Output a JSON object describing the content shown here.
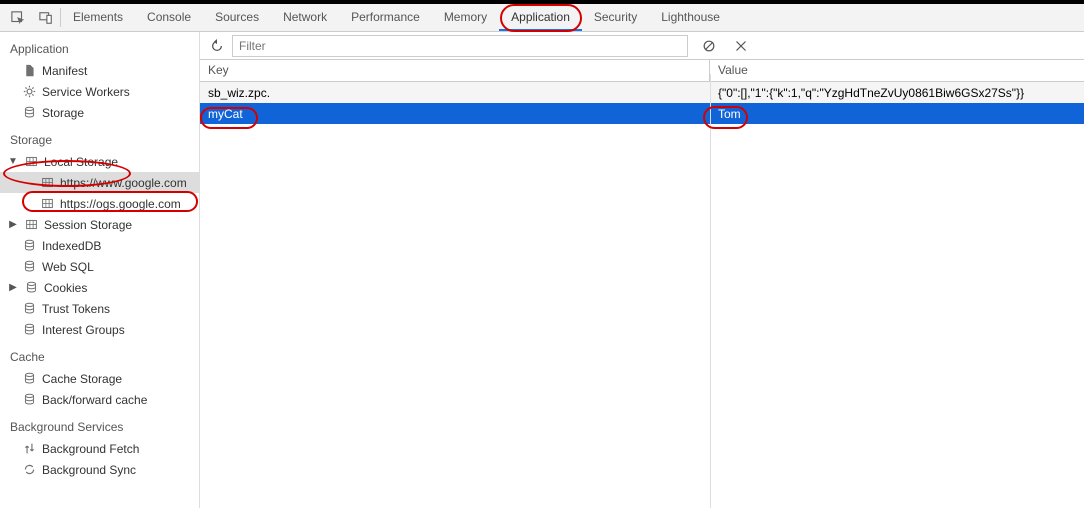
{
  "top_tabs": {
    "items": [
      "Elements",
      "Console",
      "Sources",
      "Network",
      "Performance",
      "Memory",
      "Application",
      "Security",
      "Lighthouse"
    ],
    "active_index": 6
  },
  "toolbar": {
    "filter_placeholder": "Filter"
  },
  "sidebar": {
    "sections": {
      "app": {
        "title": "Application",
        "items": [
          {
            "label": "Manifest",
            "icon": "file"
          },
          {
            "label": "Service Workers",
            "icon": "gear"
          },
          {
            "label": "Storage",
            "icon": "db"
          }
        ]
      },
      "storage": {
        "title": "Storage",
        "items": [
          {
            "label": "Local Storage",
            "icon": "grid",
            "expanded": true,
            "children": [
              {
                "label": "https://www.google.com",
                "selected": true
              },
              {
                "label": "https://ogs.google.com"
              }
            ]
          },
          {
            "label": "Session Storage",
            "icon": "grid",
            "expanded": false
          },
          {
            "label": "IndexedDB",
            "icon": "db"
          },
          {
            "label": "Web SQL",
            "icon": "db"
          },
          {
            "label": "Cookies",
            "icon": "db",
            "expanded": false
          },
          {
            "label": "Trust Tokens",
            "icon": "db"
          },
          {
            "label": "Interest Groups",
            "icon": "db"
          }
        ]
      },
      "cache": {
        "title": "Cache",
        "items": [
          {
            "label": "Cache Storage",
            "icon": "db"
          },
          {
            "label": "Back/forward cache",
            "icon": "db"
          }
        ]
      },
      "bg": {
        "title": "Background Services",
        "items": [
          {
            "label": "Background Fetch",
            "icon": "updown"
          },
          {
            "label": "Background Sync",
            "icon": "sync"
          }
        ]
      }
    }
  },
  "table": {
    "headers": {
      "key": "Key",
      "value": "Value"
    },
    "rows": [
      {
        "key": "sb_wiz.zpc.",
        "value": "{\"0\":[],\"1\":{\"k\":1,\"q\":\"YzgHdTneZvUy0861Biw6GSx27Ss\"}}"
      },
      {
        "key": "myCat",
        "value": "Tom",
        "selected": true
      }
    ]
  }
}
